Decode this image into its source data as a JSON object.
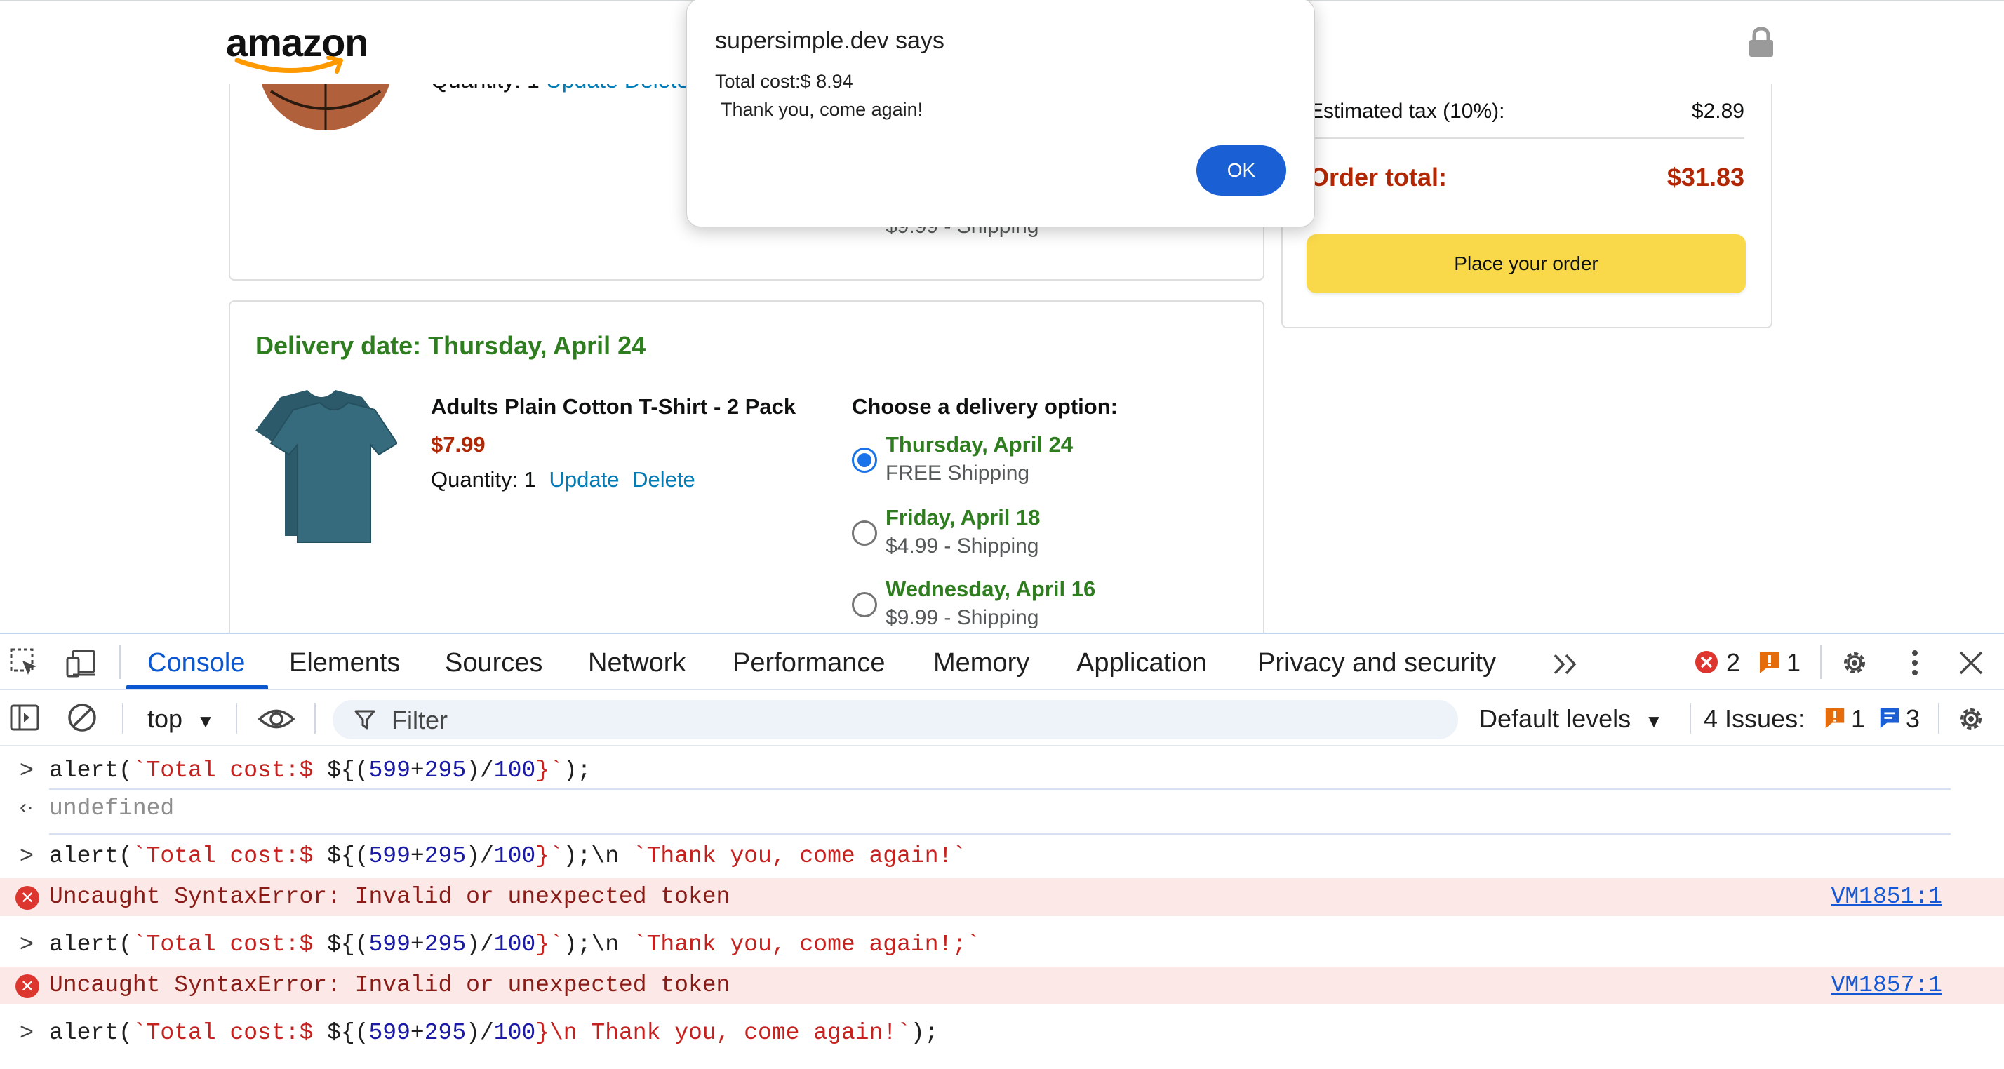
{
  "page": {
    "logo": "amazon",
    "card1": {
      "quantity_prefix": "Quantity: 1",
      "update": "Update",
      "delete": "Delete",
      "shipping_peek": "$9.99 - Shipping"
    },
    "card2": {
      "delivery_date": "Delivery date: Thursday, April 24",
      "product_name": "Adults Plain Cotton T-Shirt - 2 Pack",
      "price": "$7.99",
      "quantity": "Quantity: 1",
      "update": "Update",
      "delete": "Delete",
      "choose_label": "Choose a delivery option:",
      "options": [
        {
          "date": "Thursday, April 24",
          "shipping": "FREE Shipping",
          "checked": true
        },
        {
          "date": "Friday, April 18",
          "shipping": "$4.99 - Shipping",
          "checked": false
        },
        {
          "date": "Wednesday, April 16",
          "shipping": "$9.99 - Shipping",
          "checked": false
        }
      ]
    },
    "summary": {
      "tax_label": "Estimated tax (10%):",
      "tax_value": "$2.89",
      "total_label": "Order total:",
      "total_value": "$31.83",
      "place_order": "Place your order"
    }
  },
  "dialog": {
    "title": "supersimple.dev says",
    "message_line1": "Total cost:$ 8.94",
    "message_line2": "Thank you, come again!",
    "ok": "OK"
  },
  "devtools": {
    "tabs": [
      "Console",
      "Elements",
      "Sources",
      "Network",
      "Performance",
      "Memory",
      "Application",
      "Privacy and security"
    ],
    "active_tab": "Console",
    "more_tabs_icon": "chevron-double-right-icon",
    "error_count": "2",
    "warning_count": "1",
    "toolbar": {
      "context": "top",
      "filter_placeholder": "Filter",
      "levels": "Default levels",
      "issues_label": "4 Issues:",
      "issues_warning": "1",
      "issues_info": "3"
    },
    "console": {
      "line1": {
        "a": "alert(",
        "b": "`Total cost:$ ",
        "c": "${(",
        "d": "599",
        "e": "+",
        "f": "295",
        "g": ")/",
        "h": "100",
        "i": "}`",
        "j": ");"
      },
      "result1": "undefined",
      "line2": {
        "a": "alert(",
        "b": "`Total cost:$ ",
        "c": "${(",
        "d": "599",
        "e": "+",
        "f": "295",
        "g": ")/",
        "h": "100",
        "i": "}`",
        "j": ");\\n ",
        "k": "`Thank you, come again!`"
      },
      "error1": {
        "text": "Uncaught SyntaxError: Invalid or unexpected token",
        "link": "VM1851:1"
      },
      "line3": {
        "a": "alert(",
        "b": "`Total cost:$ ",
        "c": "${(",
        "d": "599",
        "e": "+",
        "f": "295",
        "g": ")/",
        "h": "100",
        "i": "}`",
        "j": ");\\n ",
        "k": "`Thank you, come again!;`"
      },
      "error2": {
        "text": "Uncaught SyntaxError: Invalid or unexpected token",
        "link": "VM1857:1"
      },
      "line4": {
        "a": "alert(",
        "b": "`Total cost:$ ",
        "c": "${(",
        "d": "599",
        "e": "+",
        "f": "295",
        "g": ")/",
        "h": "100",
        "i": "}\\n Thank you, come again!`",
        "j": ");"
      }
    }
  },
  "colors": {
    "amazon_yellow": "#f9d949",
    "price_red": "#b12704",
    "delivery_green": "#2e7d1f",
    "link_blue": "#017cb6",
    "devtools_blue": "#0b57d0"
  }
}
